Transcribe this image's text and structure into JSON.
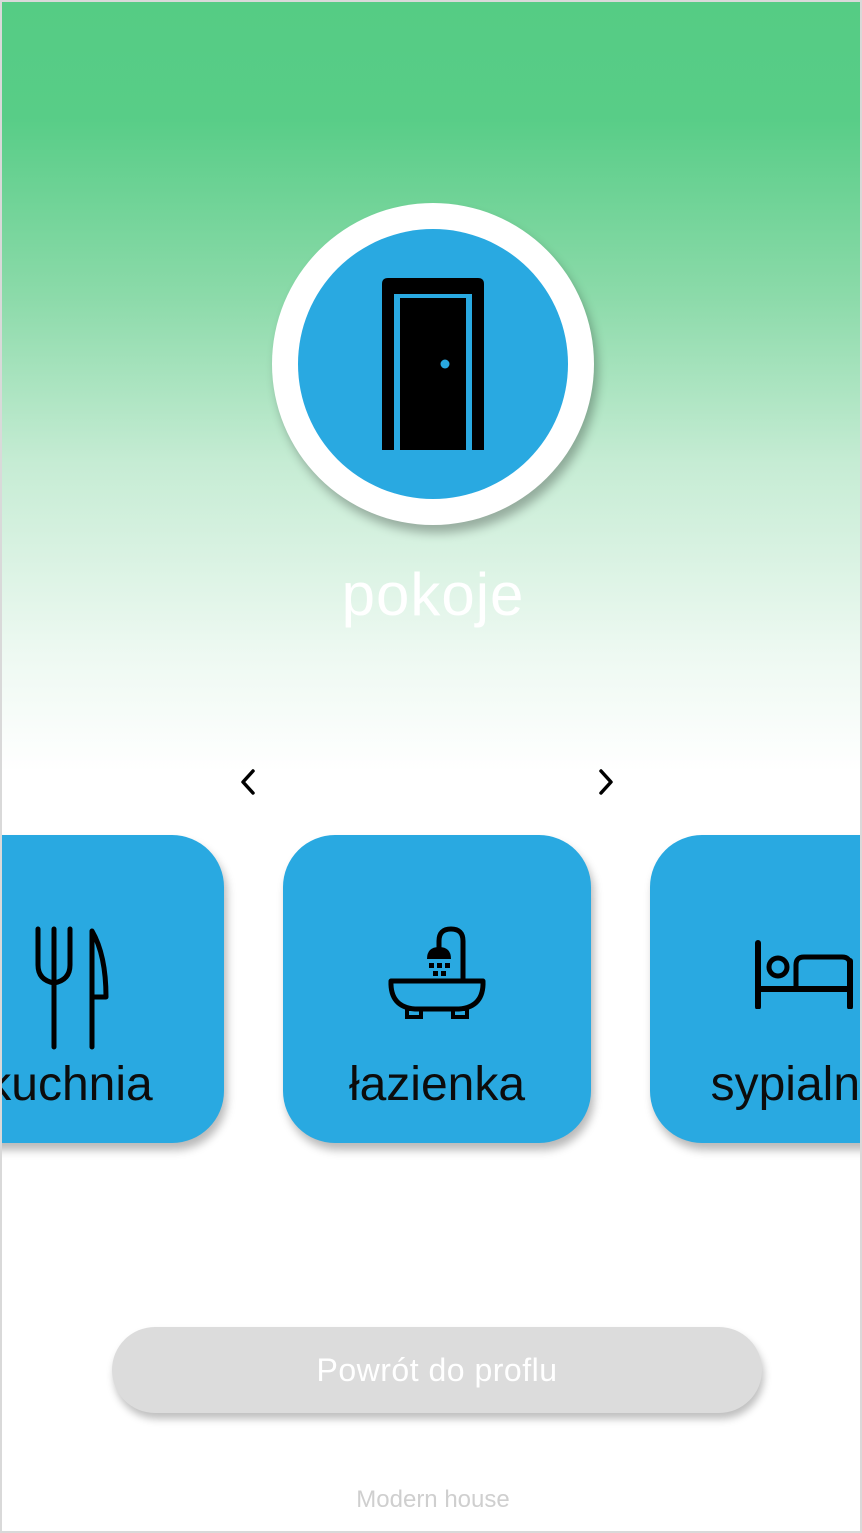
{
  "header": {
    "title": "pokoje",
    "icon": "door-icon"
  },
  "carousel": {
    "prev_icon": "chevron-left-icon",
    "next_icon": "chevron-right-icon",
    "items": [
      {
        "label": "kuchnia",
        "icon": "fork-knife-icon"
      },
      {
        "label": "łazienka",
        "icon": "bathtub-shower-icon"
      },
      {
        "label": "sypialnia",
        "icon": "bed-icon"
      }
    ]
  },
  "actions": {
    "back_label": "Powrót do proflu"
  },
  "footer": {
    "app_name": "Modern house"
  },
  "colors": {
    "accent": "#29a9e1",
    "gradient_top": "#55cc84",
    "button_disabled": "#dcdcdc"
  }
}
